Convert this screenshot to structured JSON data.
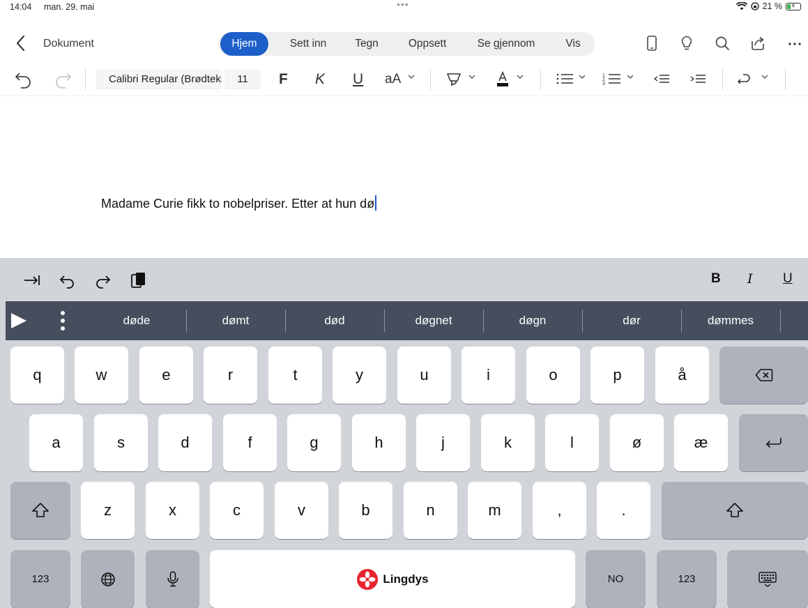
{
  "status_bar": {
    "time": "14:04",
    "date": "man. 29. mai",
    "battery": "21 %"
  },
  "nav": {
    "back_label": "Dokument",
    "tabs": [
      "Hjem",
      "Sett inn",
      "Tegn",
      "Oppsett",
      "Se gjennom",
      "Vis"
    ],
    "active_tab": "Hjem",
    "icons": [
      "phone-view-icon",
      "lightbulb-icon",
      "search-icon",
      "share-icon",
      "more-icon"
    ]
  },
  "ribbon": {
    "font_name": "Calibri Regular (Brødtekst)",
    "font_size": "11",
    "bold": "F",
    "italic": "K",
    "underline": "U",
    "text_size": "aA"
  },
  "document": {
    "text": "Madame Curie fikk to nobelpriser. Etter at hun dø"
  },
  "keyboard": {
    "toolbar": {
      "bold": "B",
      "italic": "I",
      "underline": "U"
    },
    "predictions": [
      "døde",
      "dømt",
      "død",
      "døgnet",
      "døgn",
      "dør",
      "dømmes"
    ],
    "row1": [
      "q",
      "w",
      "e",
      "r",
      "t",
      "y",
      "u",
      "i",
      "o",
      "p",
      "å"
    ],
    "row2": [
      "a",
      "s",
      "d",
      "f",
      "g",
      "h",
      "j",
      "k",
      "l",
      "ø",
      "æ"
    ],
    "row3": [
      "z",
      "x",
      "c",
      "v",
      "b",
      "n",
      "m",
      ",",
      "."
    ],
    "bottom": {
      "numbers_left": "123",
      "numbers_right": "123",
      "language": "NO",
      "space_brand": "Lingdys"
    }
  },
  "colors": {
    "accent": "#1d5fc9",
    "keyboard_bg": "#d1d4d9",
    "prediction_bar": "#464e5e",
    "brand": "#e8232f"
  }
}
